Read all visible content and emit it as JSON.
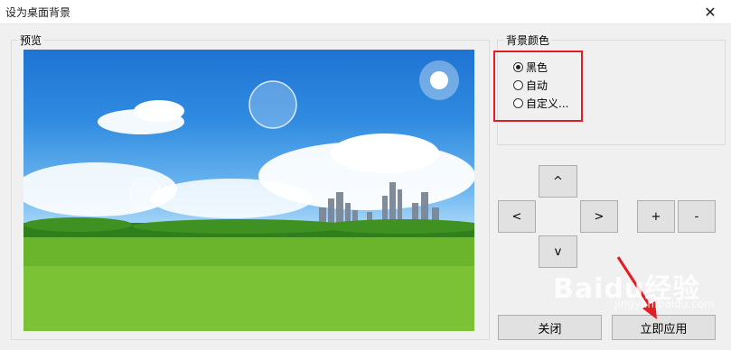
{
  "window": {
    "title": "设为桌面背景",
    "close_glyph": "✕"
  },
  "preview": {
    "legend": "预览"
  },
  "background_color": {
    "legend": "背景颜色",
    "options": [
      {
        "label": "黑色",
        "checked": true
      },
      {
        "label": "自动",
        "checked": false
      },
      {
        "label": "自定义...",
        "checked": false
      }
    ]
  },
  "nav": {
    "up": "^",
    "left": "<",
    "right": ">",
    "down": "v"
  },
  "zoom": {
    "plus": "+",
    "minus": "-"
  },
  "buttons": {
    "close": "关闭",
    "apply": "立即应用"
  },
  "annotation": {
    "highlight_color": "#e01e24",
    "arrow_color": "#e01e24"
  },
  "watermark": {
    "text": "Baidu经验",
    "subtext": "jingyan.baidu.com"
  }
}
